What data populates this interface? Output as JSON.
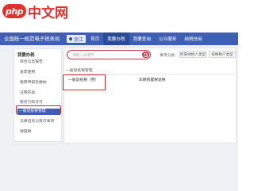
{
  "watermark": {
    "badge": "php",
    "text": "中文网"
  },
  "header": {
    "title": "全国统一规范电子税务局",
    "region": "浙江",
    "nav": [
      "首页",
      "我要办税",
      "我要查询",
      "公众服务",
      "纳税信用"
    ]
  },
  "sidebar": {
    "heading": "我要办税",
    "items": [
      "综合信息报告",
      "发票使用",
      "税费申报及缴纳",
      "证明开具",
      "税务行政许可",
      "一般退抵税管理",
      "法律追责与救济事项",
      "增值税"
    ],
    "active_index": 5
  },
  "search": {
    "placeholder": "请输入关键字"
  },
  "filters": {
    "label": "事项分类:",
    "buttons": [
      "所属纳税人类型",
      "按纳税户类型"
    ]
  },
  "section": {
    "title": "一般退抵税管理"
  },
  "items": {
    "left": "一般退抵税（费）",
    "right": "车辆购置税退税"
  },
  "colors": {
    "header": "#3e5fb6",
    "highlight": "#d02a2a",
    "search_accent": "#c7364a"
  }
}
